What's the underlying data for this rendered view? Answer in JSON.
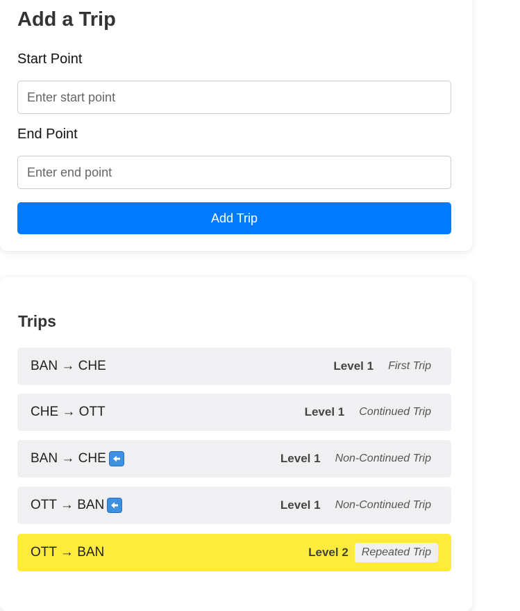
{
  "form": {
    "title": "Add a Trip",
    "start_label": "Start Point",
    "start_placeholder": "Enter start point",
    "start_value": "",
    "end_label": "End Point",
    "end_placeholder": "Enter end point",
    "end_value": "",
    "submit_label": "Add Trip",
    "accent_color": "#007bff"
  },
  "trips": {
    "title": "Trips",
    "highlight_color": "#ffeb3b",
    "items": [
      {
        "route": "BAN → CHE",
        "level": "Level 1",
        "type": "First Trip",
        "return_icon": false
      },
      {
        "route": "CHE → OTT",
        "level": "Level 1",
        "type": "Continued Trip",
        "return_icon": false
      },
      {
        "route": "BAN → CHE",
        "level": "Level 1",
        "type": "Non-Continued Trip",
        "return_icon": true,
        "icon": "left-arrow-icon"
      },
      {
        "route": "OTT → BAN",
        "level": "Level 1",
        "type": "Non-Continued Trip",
        "return_icon": true,
        "icon": "left-arrow-icon"
      },
      {
        "route": "OTT → BAN",
        "level": "Level 2",
        "type": "Repeated Trip",
        "return_icon": false,
        "highlighted": true
      }
    ]
  }
}
